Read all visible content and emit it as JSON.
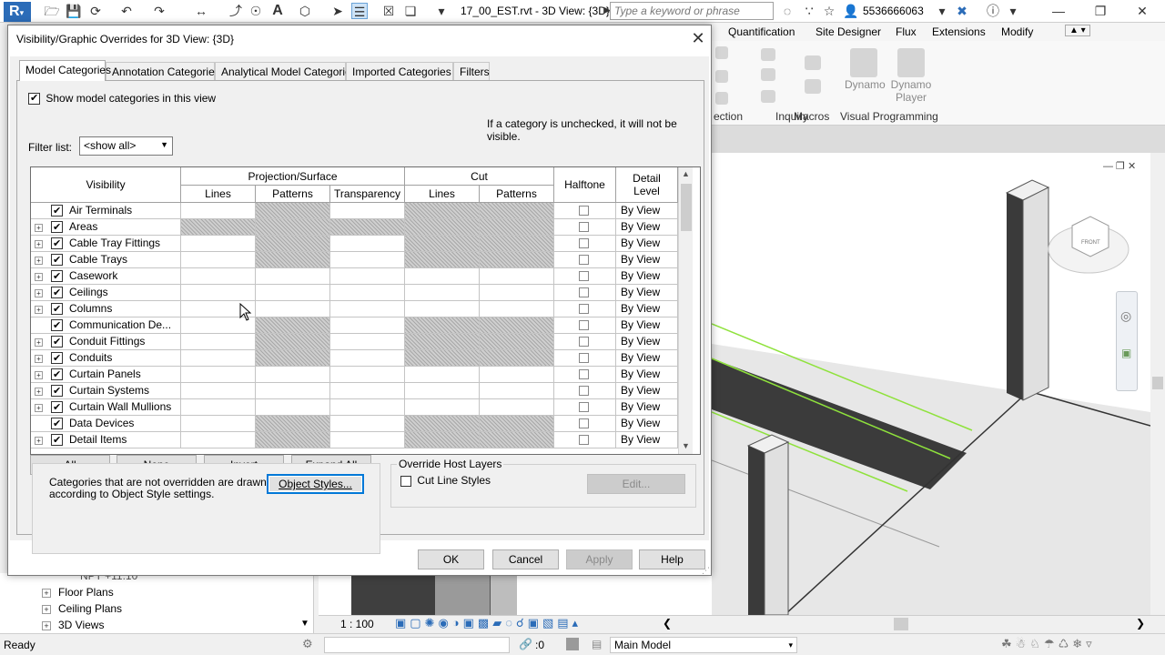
{
  "app": {
    "doc_title": "17_00_EST.rvt - 3D View: {3D}",
    "search_placeholder": "Type a keyword or phrase",
    "user": "5536666063",
    "logo": "R"
  },
  "ribbon": {
    "tabs": [
      "Quantification",
      "Site Designer",
      "Flux",
      "Extensions",
      "Modify"
    ],
    "panels": [
      "ection",
      "Inquiry",
      "Macros",
      "Visual Programming"
    ],
    "buttons": {
      "dynamo": "Dynamo",
      "dynamo_player": "Dynamo Player"
    }
  },
  "dialog": {
    "title": "Visibility/Graphic Overrides for 3D View: {3D}",
    "tabs": [
      "Model Categories",
      "Annotation Categories",
      "Analytical Model Categories",
      "Imported Categories",
      "Filters"
    ],
    "show_model_label": "Show model categories in this view",
    "note": "If a category is unchecked, it will not be visible.",
    "filter_label": "Filter list:",
    "filter_value": "<show all>",
    "headers": {
      "visibility": "Visibility",
      "projection": "Projection/Surface",
      "cut": "Cut",
      "lines": "Lines",
      "patterns": "Patterns",
      "transparency": "Transparency",
      "halftone": "Halftone",
      "detail_level": "Detail Level"
    },
    "rows": [
      {
        "name": "Air Terminals",
        "expander": false,
        "pl": false,
        "pp": true,
        "pt": false,
        "cl": true,
        "cp": true,
        "detail": "By View"
      },
      {
        "name": "Areas",
        "expander": true,
        "pl": true,
        "pp": true,
        "pt": true,
        "cl": true,
        "cp": true,
        "detail": "By View"
      },
      {
        "name": "Cable Tray Fittings",
        "expander": true,
        "pl": false,
        "pp": true,
        "pt": false,
        "cl": true,
        "cp": true,
        "detail": "By View"
      },
      {
        "name": "Cable Trays",
        "expander": true,
        "pl": false,
        "pp": true,
        "pt": false,
        "cl": true,
        "cp": true,
        "detail": "By View"
      },
      {
        "name": "Casework",
        "expander": true,
        "pl": false,
        "pp": false,
        "pt": false,
        "cl": false,
        "cp": false,
        "detail": "By View"
      },
      {
        "name": "Ceilings",
        "expander": true,
        "pl": false,
        "pp": false,
        "pt": false,
        "cl": false,
        "cp": false,
        "detail": "By View"
      },
      {
        "name": "Columns",
        "expander": true,
        "pl": false,
        "pp": false,
        "pt": false,
        "cl": false,
        "cp": false,
        "detail": "By View"
      },
      {
        "name": "Communication De...",
        "expander": false,
        "pl": false,
        "pp": true,
        "pt": false,
        "cl": true,
        "cp": true,
        "detail": "By View"
      },
      {
        "name": "Conduit Fittings",
        "expander": true,
        "pl": false,
        "pp": true,
        "pt": false,
        "cl": true,
        "cp": true,
        "detail": "By View"
      },
      {
        "name": "Conduits",
        "expander": true,
        "pl": false,
        "pp": true,
        "pt": false,
        "cl": true,
        "cp": true,
        "detail": "By View"
      },
      {
        "name": "Curtain Panels",
        "expander": true,
        "pl": false,
        "pp": false,
        "pt": false,
        "cl": false,
        "cp": false,
        "detail": "By View"
      },
      {
        "name": "Curtain Systems",
        "expander": true,
        "pl": false,
        "pp": false,
        "pt": false,
        "cl": false,
        "cp": false,
        "detail": "By View"
      },
      {
        "name": "Curtain Wall Mullions",
        "expander": true,
        "pl": false,
        "pp": false,
        "pt": false,
        "cl": false,
        "cp": false,
        "detail": "By View"
      },
      {
        "name": "Data Devices",
        "expander": false,
        "pl": false,
        "pp": true,
        "pt": false,
        "cl": true,
        "cp": true,
        "detail": "By View"
      },
      {
        "name": "Detail Items",
        "expander": true,
        "pl": false,
        "pp": true,
        "pt": false,
        "cl": true,
        "cp": true,
        "detail": "By View"
      }
    ],
    "buttons": {
      "all": "All",
      "none": "None",
      "invert": "Invert",
      "expand_all": "Expand All",
      "object_styles": "Object Styles...",
      "edit": "Edit...",
      "ok": "OK",
      "cancel": "Cancel",
      "apply": "Apply",
      "help": "Help"
    },
    "info_text": "Categories that are not overridden are drawn according to Object Style settings.",
    "override_host_label": "Override Host Layers",
    "cut_line_label": "Cut Line Styles"
  },
  "browser": {
    "items": [
      "NPT +11.10",
      "Floor Plans",
      "Ceiling Plans",
      "3D Views"
    ]
  },
  "view_control": {
    "scale": "1 : 100"
  },
  "status": {
    "text": "Ready",
    "count": ":0",
    "model": "Main Model"
  }
}
